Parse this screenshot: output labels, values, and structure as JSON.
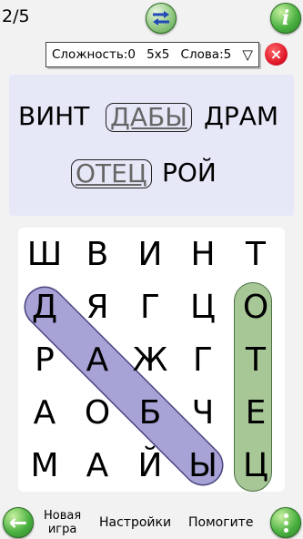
{
  "top": {
    "progress": "2/5",
    "selector": {
      "difficulty": "Сложность:0",
      "size": "5x5",
      "words": "Слова:5",
      "arrow": "▽"
    },
    "close_label": "×",
    "info_label": "i"
  },
  "words": [
    {
      "text": "ВИНТ",
      "found": false
    },
    {
      "text": "ДАБЫ",
      "found": true
    },
    {
      "text": "ДРАМ",
      "found": false
    },
    {
      "text": "ОТЕЦ",
      "found": true
    },
    {
      "text": "РОЙ",
      "found": false
    }
  ],
  "grid": [
    [
      "Ш",
      "В",
      "И",
      "Н",
      "Т"
    ],
    [
      "Д",
      "Я",
      "Г",
      "Ц",
      "О"
    ],
    [
      "Р",
      "А",
      "Ж",
      "Г",
      "Т"
    ],
    [
      "А",
      "О",
      "Б",
      "Ч",
      "Е"
    ],
    [
      "М",
      "А",
      "Й",
      "Ы",
      "Ц"
    ]
  ],
  "highlights": [
    {
      "word": "ДАБЫ",
      "from": [
        1,
        0
      ],
      "to": [
        4,
        3
      ],
      "color": "#a7a3d6"
    },
    {
      "word": "ОТЕЦ",
      "from": [
        1,
        4
      ],
      "to": [
        4,
        4
      ],
      "color": "#a7c797"
    }
  ],
  "bottom": {
    "back_label": "←",
    "new_game_line1": "Новая",
    "new_game_line2": "игра",
    "settings": "Настройки",
    "help": "Помогите"
  }
}
